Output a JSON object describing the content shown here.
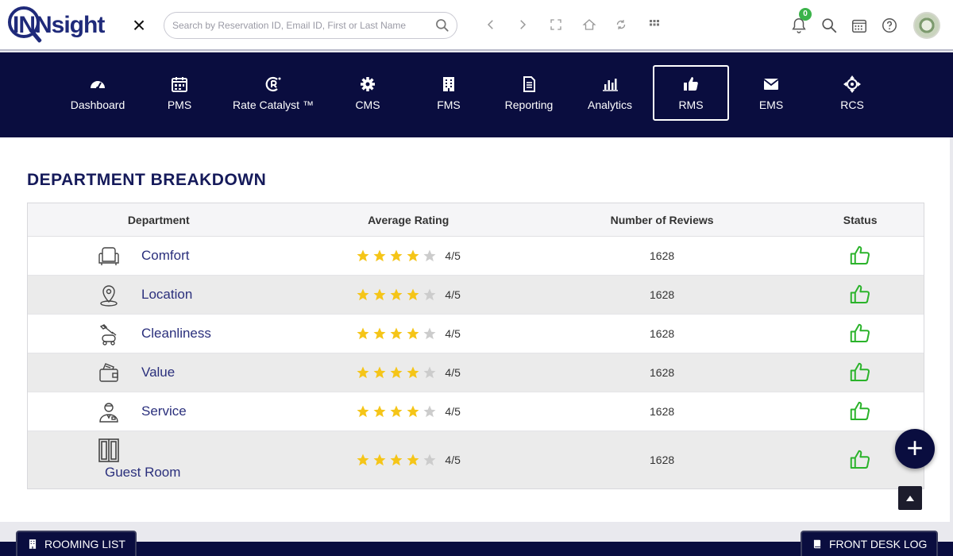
{
  "app": {
    "logo_text": "INNsight"
  },
  "search": {
    "placeholder": "Search by Reservation ID, Email ID, First or Last Name"
  },
  "notifications": {
    "count": "0"
  },
  "nav": [
    {
      "label": "Dashboard",
      "icon": "dashboard-icon"
    },
    {
      "label": "PMS",
      "icon": "calendar-icon"
    },
    {
      "label": "Rate Catalyst ™",
      "icon": "rate-catalyst-icon"
    },
    {
      "label": "CMS",
      "icon": "gear-icon"
    },
    {
      "label": "FMS",
      "icon": "building-icon"
    },
    {
      "label": "Reporting",
      "icon": "document-icon"
    },
    {
      "label": "Analytics",
      "icon": "bar-chart-icon"
    },
    {
      "label": "RMS",
      "icon": "thumbs-up-icon",
      "active": true
    },
    {
      "label": "EMS",
      "icon": "envelope-icon"
    },
    {
      "label": "RCS",
      "icon": "crosshair-icon"
    }
  ],
  "section": {
    "title": "DEPARTMENT BREAKDOWN"
  },
  "table": {
    "headers": {
      "department": "Department",
      "rating": "Average Rating",
      "reviews": "Number of Reviews",
      "status": "Status"
    },
    "rows": [
      {
        "department": "Comfort",
        "icon": "armchair-icon",
        "stars": 4,
        "rating": "4/5",
        "reviews": "1628",
        "status": "thumbs-up-icon"
      },
      {
        "department": "Location",
        "icon": "map-pin-icon",
        "stars": 4,
        "rating": "4/5",
        "reviews": "1628",
        "status": "thumbs-up-icon"
      },
      {
        "department": "Cleanliness",
        "icon": "vacuum-icon",
        "stars": 4,
        "rating": "4/5",
        "reviews": "1628",
        "status": "thumbs-up-icon"
      },
      {
        "department": "Value",
        "icon": "wallet-icon",
        "stars": 4,
        "rating": "4/5",
        "reviews": "1628",
        "status": "thumbs-up-icon"
      },
      {
        "department": "Service",
        "icon": "staff-person-icon",
        "stars": 4,
        "rating": "4/5",
        "reviews": "1628",
        "status": "thumbs-up-icon"
      },
      {
        "department": "Guest Room",
        "icon": "door-icon",
        "stars": 4,
        "rating": "4/5",
        "reviews": "1628",
        "status": "thumbs-up-icon"
      }
    ]
  },
  "footer": {
    "rooming_list": "ROOMING LIST",
    "front_desk_log": "FRONT DESK LOG"
  },
  "colors": {
    "nav_bg": "#0a0d3f",
    "star": "#f5c518",
    "star_empty": "#cccccc",
    "thumb": "#2bb32b",
    "title": "#151a5a"
  }
}
